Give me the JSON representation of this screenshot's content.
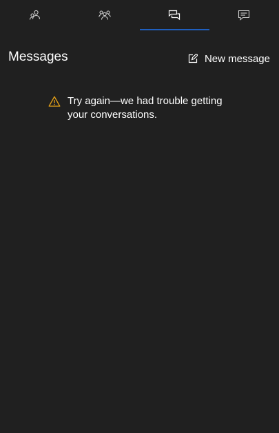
{
  "tabs": [
    {
      "icon": "person-icon",
      "active": false
    },
    {
      "icon": "people-group-icon",
      "active": false
    },
    {
      "icon": "conversations-icon",
      "active": true
    },
    {
      "icon": "chat-bubble-icon",
      "active": false
    }
  ],
  "header": {
    "title": "Messages",
    "new_message_label": "New message",
    "new_message_icon": "compose-icon"
  },
  "error": {
    "icon": "warning-icon",
    "line1": "Try again—we had trouble getting",
    "line2": "your conversations."
  },
  "colors": {
    "background": "#202020",
    "accent": "#1f5fbf",
    "warning": "#e8a317",
    "icon": "#cfcfcf"
  }
}
